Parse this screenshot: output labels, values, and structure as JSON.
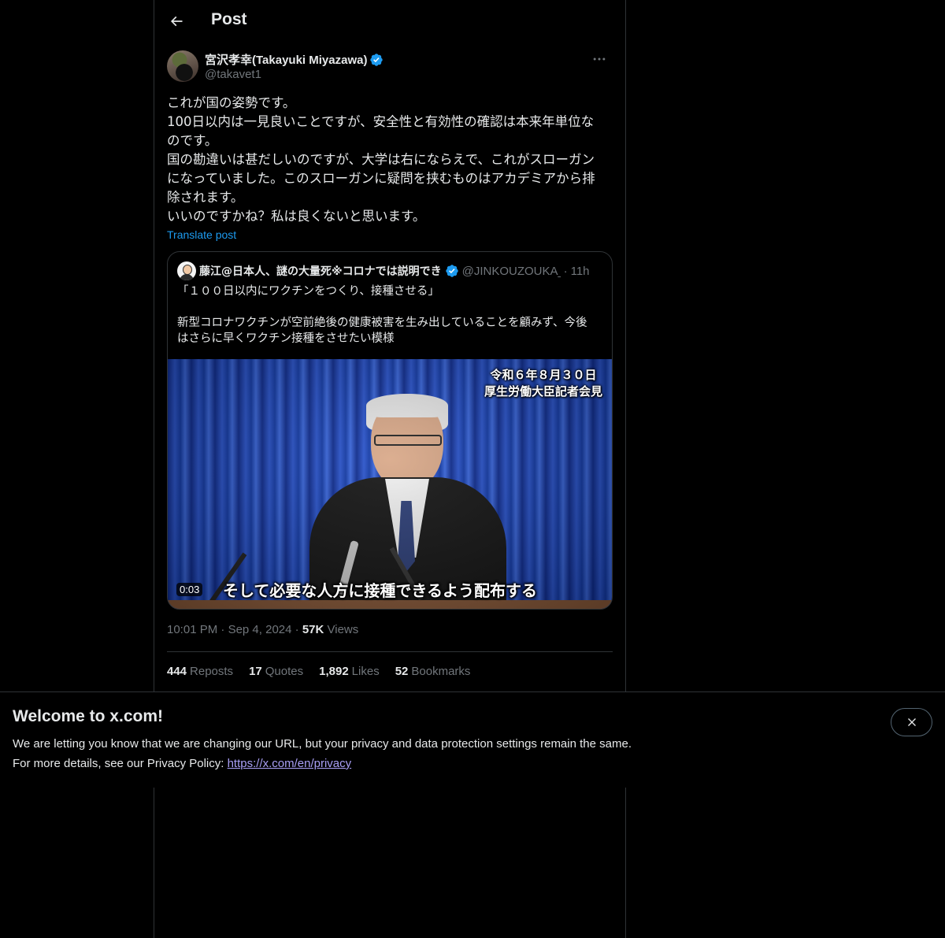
{
  "header": {
    "title": "Post"
  },
  "post": {
    "author": {
      "display_name": "宮沢孝幸(Takayuki Miyazawa)",
      "handle": "@takavet1",
      "verified": true
    },
    "text_lines": [
      "これが国の姿勢です。",
      "100日以内は一見良いことですが、安全性と有効性の確認は本来年単位な",
      "のです。",
      "国の勘違いは甚だしいのですが、大学は右にならえで、これがスローガン",
      "になっていました。このスローガンに疑問を挟むものはアカデミアから排",
      "除されます。",
      "いいのですかね？私は良くないと思います。"
    ],
    "translate_label": "Translate post",
    "quote": {
      "author_name": "藤江@日本人、謎の大量死※コロナでは説明でき",
      "handle": "@JINKOUZOUKA_",
      "separator": "·",
      "time": "11h",
      "text_lines": [
        "「１００日以内にワクチンをつくり、接種させる」",
        "",
        "新型コロナワクチンが空前絶後の健康被害を生み出していることを顧みず、今後",
        "はさらに早くワクチン接種をさせたい模様"
      ],
      "video": {
        "caption_top_line1": "令和６年８月３０日",
        "caption_top_line2": "厚生労働大臣記者会見",
        "subtitle": "そして必要な人方に接種できるよう配布する",
        "duration": "0:03"
      }
    },
    "meta": {
      "time": "10:01 PM",
      "sep1": "·",
      "date": "Sep 4, 2024",
      "sep2": "·",
      "views_count": "57K",
      "views_label": "Views"
    },
    "stats": [
      {
        "count": "444",
        "label": "Reposts"
      },
      {
        "count": "17",
        "label": "Quotes"
      },
      {
        "count": "1,892",
        "label": "Likes"
      },
      {
        "count": "52",
        "label": "Bookmarks"
      }
    ]
  },
  "banner": {
    "title": "Welcome to x.com!",
    "line1": "We are letting you know that we are changing our URL, but your privacy and data protection settings remain the same.",
    "line2_prefix": "For more details, see our Privacy Policy: ",
    "link_text": "https://x.com/en/privacy"
  },
  "icons": {
    "back": "arrow-left-icon",
    "more": "more-horizontal-icon",
    "verified": "verified-badge-icon",
    "close": "close-icon"
  },
  "colors": {
    "background": "#000000",
    "text": "#e7e9ea",
    "muted": "#71767b",
    "accent": "#1d9bf0",
    "link": "#a99ff5",
    "border": "#2f3336"
  }
}
